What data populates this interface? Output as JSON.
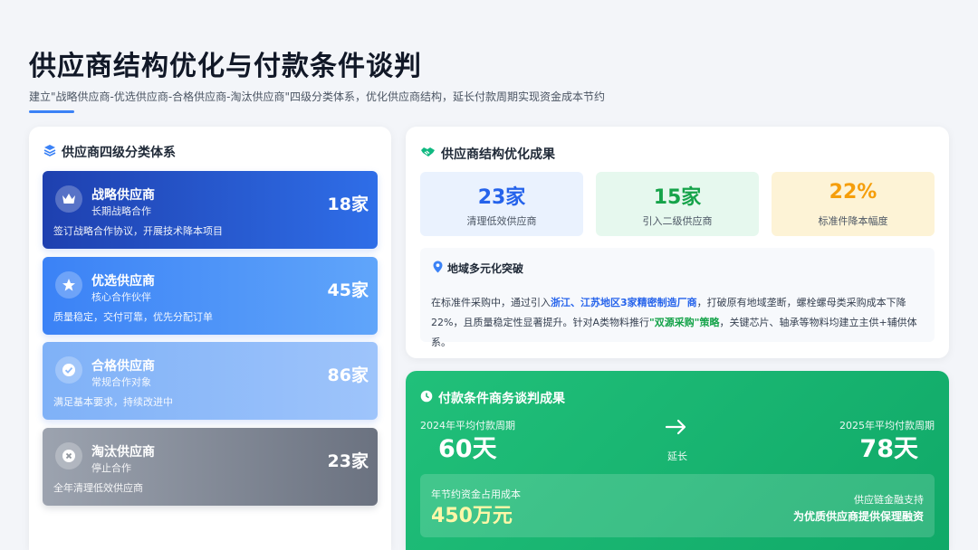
{
  "header": {
    "title": "供应商结构优化与付款条件谈判",
    "subtitle": "建立\"战略供应商-优选供应商-合格供应商-淘汰供应商\"四级分类体系，优化供应商结构，延长付款周期实现资金成本节约"
  },
  "classification": {
    "title": "供应商四级分类体系",
    "icon": "layers-icon",
    "tiers": [
      {
        "name": "战略供应商",
        "sub": "长期战略合作",
        "count": "18家",
        "desc": "签订战略合作协议，开展技术降本项目",
        "icon": "crown-icon"
      },
      {
        "name": "优选供应商",
        "sub": "核心合作伙伴",
        "count": "45家",
        "desc": "质量稳定，交付可靠，优先分配订单",
        "icon": "star-icon"
      },
      {
        "name": "合格供应商",
        "sub": "常规合作对象",
        "count": "86家",
        "desc": "满足基本要求，持续改进中",
        "icon": "check-circle-icon"
      },
      {
        "name": "淘汰供应商",
        "sub": "停止合作",
        "count": "23家",
        "desc": "全年清理低效供应商",
        "icon": "x-circle-icon"
      }
    ]
  },
  "optimization": {
    "title": "供应商结构优化成果",
    "icon": "handshake-icon",
    "stats": [
      {
        "value": "23家",
        "label": "清理低效供应商"
      },
      {
        "value": "15家",
        "label": "引入二级供应商"
      },
      {
        "value": "22%",
        "label": "标准件降本幅度"
      }
    ],
    "region": {
      "title": "地域多元化突破",
      "icon": "location-pin-icon",
      "text_1": "在标准件采购中，通过引入",
      "hl_1": "浙江、江苏地区3家精密制造厂商",
      "text_2": "，打破原有地域垄断，螺栓螺母类采购成本下降22%，且质量稳定性显著提升。针对A类物料推行",
      "hl_2": "\"双源采购\"策略",
      "text_3": "，关键芯片、轴承等物料均建立主供+辅供体系。"
    }
  },
  "payment": {
    "title": "付款条件商务谈判成果",
    "icon": "clock-icon",
    "before_label": "2024年平均付款周期",
    "before_value": "60天",
    "arrow_icon": "arrow-right-icon",
    "extend_label": "延长",
    "after_label": "2025年平均付款周期",
    "after_value": "78天",
    "saving_label": "年节约资金占用成本",
    "saving_value": "450万元",
    "finance_label": "供应链金融支持",
    "finance_value": "为优质供应商提供保理融资"
  },
  "colors": {
    "accent_blue": "#2563eb",
    "accent_green": "#16a34a",
    "accent_amber": "#f59e0b",
    "payment_green": "#16b06f"
  }
}
